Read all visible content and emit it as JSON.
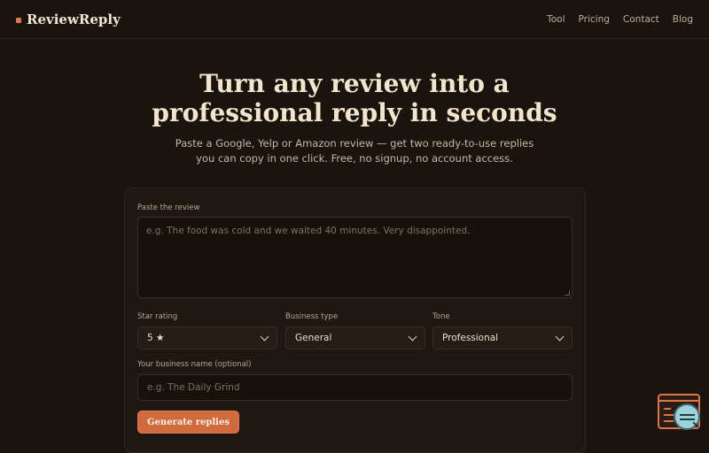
{
  "brand": {
    "name": "ReviewReply"
  },
  "nav": {
    "items": [
      "Tool",
      "Pricing",
      "Contact",
      "Blog"
    ]
  },
  "hero": {
    "title_line1": "Turn any review into a",
    "title_line2": "professional reply in seconds",
    "subtitle_line1": "Paste a Google, Yelp or Amazon review — get two ready-to-use replies",
    "subtitle_line2": "you can copy in one click. Free, no signup, no account access."
  },
  "form": {
    "review_label": "Paste the review",
    "review_placeholder": "e.g. The food was cold and we waited 40 minutes. Very disappointed.",
    "star_label": "Star rating",
    "star_value": "5 ★",
    "business_label": "Business type",
    "business_value": "General",
    "tone_label": "Tone",
    "tone_value": "Professional",
    "name_label": "Your business name (optional)",
    "name_placeholder": "e.g. The Daily Grind",
    "submit_label": "Generate replies"
  },
  "colors": {
    "background": "#1a130e",
    "accent": "#cf6a3f",
    "text": "#e8dcc8"
  },
  "icons": {
    "brand": "square-dot-icon",
    "select": "chevron-down-icon",
    "widget": "browser-window-icon",
    "widget_badge": "assistant-badge-icon"
  }
}
